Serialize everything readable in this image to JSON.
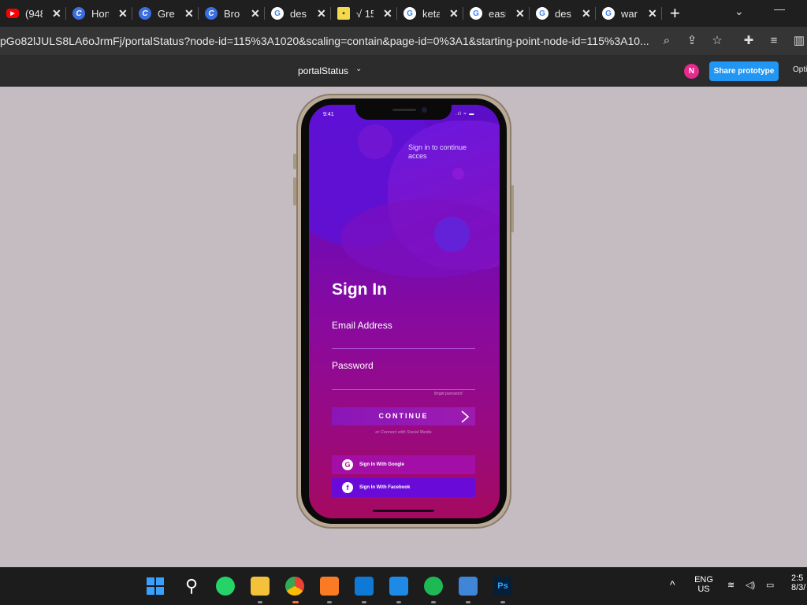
{
  "browser": {
    "tabs": [
      {
        "favicon": "youtube-icon",
        "title": "(948"
      },
      {
        "favicon": "canva-icon",
        "title": "Hon"
      },
      {
        "favicon": "canva-icon",
        "title": "Gre"
      },
      {
        "favicon": "canva-icon",
        "title": "Bro"
      },
      {
        "favicon": "google-icon",
        "title": "des"
      },
      {
        "favicon": "note-icon",
        "title": "√ 15"
      },
      {
        "favicon": "google-icon",
        "title": "keta"
      },
      {
        "favicon": "google-icon",
        "title": "easi"
      },
      {
        "favicon": "google-icon",
        "title": "des"
      },
      {
        "favicon": "google-icon",
        "title": "war"
      }
    ],
    "url": "pGo82lJULS8LA6oJrmFj/portalStatus?node-id=115%3A1020&scaling=contain&page-id=0%3A1&starting-point-node-id=115%3A10..."
  },
  "figma": {
    "page_name": "portalStatus",
    "avatar_initial": "N",
    "share_label": "Share prototype",
    "options_label": "Opti"
  },
  "phone": {
    "status_time": "9:41",
    "subtitle": "Sign in to continue acces",
    "title": "Sign In",
    "email_label": "Email Address",
    "password_label": "Password",
    "forgot": "forget password",
    "continue": "CONTINUE",
    "or_text": "or Connect with Social Media",
    "google_label": "Sign In With Google",
    "facebook_label": "Sign In With Facebook",
    "google_color": "#a30ea6",
    "facebook_color": "#6a0ad8"
  },
  "taskbar": {
    "lang_1": "ENG",
    "lang_2": "US",
    "time": "2:5",
    "date": "8/3/"
  }
}
